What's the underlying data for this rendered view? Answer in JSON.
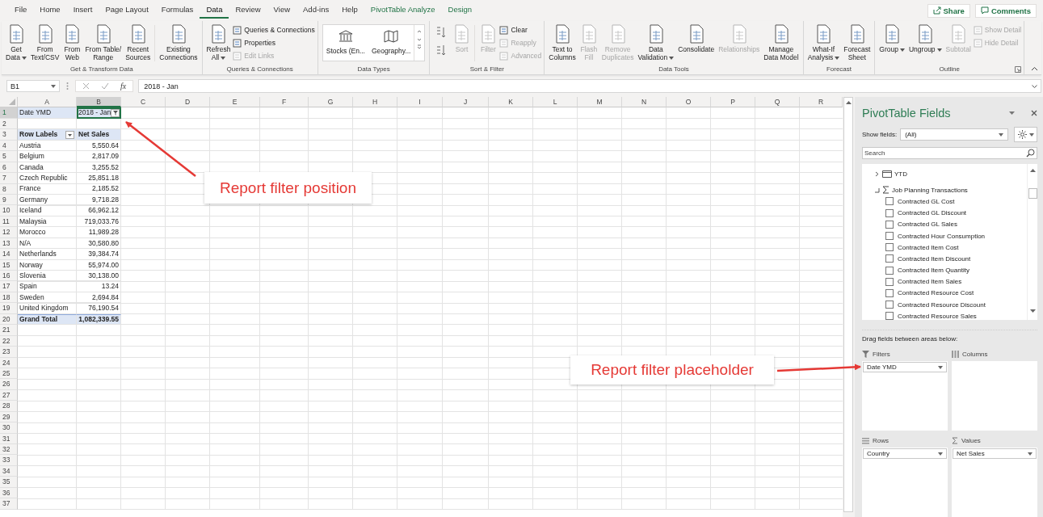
{
  "menu_tabs": [
    {
      "label": "File",
      "selected": false,
      "kind": "standard"
    },
    {
      "label": "Home",
      "selected": false,
      "kind": "standard"
    },
    {
      "label": "Insert",
      "selected": false,
      "kind": "standard"
    },
    {
      "label": "Page Layout",
      "selected": false,
      "kind": "standard"
    },
    {
      "label": "Formulas",
      "selected": false,
      "kind": "standard"
    },
    {
      "label": "Data",
      "selected": true,
      "kind": "standard"
    },
    {
      "label": "Review",
      "selected": false,
      "kind": "standard"
    },
    {
      "label": "View",
      "selected": false,
      "kind": "standard"
    },
    {
      "label": "Add-ins",
      "selected": false,
      "kind": "standard"
    },
    {
      "label": "Help",
      "selected": false,
      "kind": "standard"
    },
    {
      "label": "PivotTable Analyze",
      "selected": false,
      "kind": "contextual"
    },
    {
      "label": "Design",
      "selected": false,
      "kind": "contextual"
    }
  ],
  "top_buttons": [
    {
      "label": "Share",
      "kind": "share"
    },
    {
      "label": "Comments",
      "kind": "comments"
    }
  ],
  "ribbon": {
    "groups": [
      {
        "label": "Get & Transform Data",
        "items": [
          {
            "kind": "large",
            "lines": [
              "Get",
              "Data"
            ],
            "dropdown": true,
            "disabled": false
          },
          {
            "kind": "large",
            "lines": [
              "From",
              "Text/CSV"
            ],
            "disabled": false
          },
          {
            "kind": "large",
            "lines": [
              "From",
              "Web"
            ],
            "disabled": false
          },
          {
            "kind": "large",
            "lines": [
              "From Table/",
              "Range"
            ],
            "disabled": false
          },
          {
            "kind": "large",
            "lines": [
              "Recent",
              "Sources"
            ],
            "disabled": false
          },
          {
            "kind": "separator"
          },
          {
            "kind": "large",
            "lines": [
              "Existing",
              "Connections"
            ],
            "disabled": false
          }
        ]
      },
      {
        "label": "Queries & Connections",
        "items": [
          {
            "kind": "large",
            "lines": [
              "Refresh",
              "All"
            ],
            "dropdown": true,
            "disabled": false
          },
          {
            "kind": "small_stack",
            "items": [
              {
                "label": "Queries & Connections",
                "disabled": false
              },
              {
                "label": "Properties",
                "disabled": false
              },
              {
                "label": "Edit Links",
                "disabled": true
              }
            ]
          }
        ]
      },
      {
        "label": "Data Types",
        "items": [
          {
            "kind": "gallery",
            "options": [
              "Stocks (En...",
              "Geography..."
            ]
          }
        ]
      },
      {
        "label": "Sort & Filter",
        "items": [
          {
            "kind": "sort_pair",
            "disabled": false
          },
          {
            "kind": "large",
            "lines": [
              "Sort"
            ],
            "disabled": true
          },
          {
            "kind": "separator"
          },
          {
            "kind": "large",
            "lines": [
              "Filter"
            ],
            "disabled": true
          },
          {
            "kind": "small_stack",
            "items": [
              {
                "label": "Clear",
                "disabled": false
              },
              {
                "label": "Reapply",
                "disabled": true
              },
              {
                "label": "Advanced",
                "disabled": true
              }
            ]
          }
        ]
      },
      {
        "label": "Data Tools",
        "items": [
          {
            "kind": "large",
            "lines": [
              "Text to",
              "Columns"
            ],
            "disabled": false
          },
          {
            "kind": "large",
            "lines": [
              "Flash",
              "Fill"
            ],
            "disabled": true
          },
          {
            "kind": "large",
            "lines": [
              "Remove",
              "Duplicates"
            ],
            "disabled": true
          },
          {
            "kind": "large",
            "lines": [
              "Data",
              "Validation"
            ],
            "dropdown": true,
            "disabled": false
          },
          {
            "kind": "large",
            "lines": [
              "Consolidate"
            ],
            "disabled": false
          },
          {
            "kind": "large",
            "lines": [
              "Relationships"
            ],
            "disabled": true
          },
          {
            "kind": "large",
            "lines": [
              "Manage",
              "Data Model"
            ],
            "disabled": false
          }
        ]
      },
      {
        "label": "Forecast",
        "items": [
          {
            "kind": "large",
            "lines": [
              "What-If",
              "Analysis"
            ],
            "dropdown": true,
            "disabled": false
          },
          {
            "kind": "large",
            "lines": [
              "Forecast",
              "Sheet"
            ],
            "disabled": false
          }
        ]
      },
      {
        "label": "Outline",
        "launcher": true,
        "items": [
          {
            "kind": "large",
            "lines": [
              "Group"
            ],
            "dropdown": true,
            "disabled": false
          },
          {
            "kind": "large",
            "lines": [
              "Ungroup"
            ],
            "dropdown": true,
            "disabled": false
          },
          {
            "kind": "large",
            "lines": [
              "Subtotal"
            ],
            "disabled": true
          },
          {
            "kind": "small_stack",
            "items": [
              {
                "label": "Show Detail",
                "disabled": true
              },
              {
                "label": "Hide Detail",
                "disabled": true
              }
            ]
          }
        ]
      }
    ]
  },
  "formula_bar": {
    "name_box": "B1",
    "function_label": "fx",
    "formula": "2018 - Jan"
  },
  "sheet": {
    "columns": [
      "A",
      "B",
      "C",
      "D",
      "E",
      "F",
      "G",
      "H",
      "I",
      "J",
      "K",
      "L",
      "M",
      "N",
      "O",
      "P",
      "Q",
      "R"
    ],
    "row_numbers": [
      "1",
      "2",
      "3",
      "4",
      "5",
      "6",
      "7",
      "8",
      "9",
      "10",
      "11",
      "12",
      "13",
      "14",
      "15",
      "16",
      "17",
      "18",
      "19",
      "20",
      "21",
      "22",
      "23",
      "24",
      "25",
      "26",
      "27",
      "28",
      "29",
      "30",
      "31",
      "32",
      "33",
      "34",
      "35",
      "36",
      "37"
    ],
    "report_filter": {
      "label": "Date YMD",
      "value": "2018 - Jan",
      "selected": true
    },
    "pivot_header": {
      "row_labels": "Row Labels",
      "value_header": "Net Sales"
    },
    "pivot_rows": [
      {
        "label": "Austria",
        "value": "5,550.64"
      },
      {
        "label": "Belgium",
        "value": "2,817.09"
      },
      {
        "label": "Canada",
        "value": "3,255.52"
      },
      {
        "label": "Czech Republic",
        "value": "25,851.18"
      },
      {
        "label": "France",
        "value": "2,185.52"
      },
      {
        "label": "Germany",
        "value": "9,718.28"
      },
      {
        "label": "Iceland",
        "value": "66,962.12"
      },
      {
        "label": "Malaysia",
        "value": "719,033.76"
      },
      {
        "label": "Morocco",
        "value": "11,989.28"
      },
      {
        "label": "N/A",
        "value": "30,580.80"
      },
      {
        "label": "Netherlands",
        "value": "39,384.74"
      },
      {
        "label": "Norway",
        "value": "55,974.00"
      },
      {
        "label": "Slovenia",
        "value": "30,138.00"
      },
      {
        "label": "Spain",
        "value": "13.24"
      },
      {
        "label": "Sweden",
        "value": "2,694.84"
      },
      {
        "label": "United Kingdom",
        "value": "76,190.54"
      }
    ],
    "grand_total": {
      "label": "Grand Total",
      "value": "1,082,339.55"
    }
  },
  "annotations": [
    {
      "text": "Report filter position"
    },
    {
      "text": "Report filter placeholder"
    }
  ],
  "pivot_panel": {
    "title": "PivotTable Fields",
    "show_fields_label": "Show fields:",
    "show_fields_value": "(All)",
    "search_placeholder": "Search",
    "fields": [
      {
        "label": "YTD",
        "kind": "folder",
        "expanded": false
      },
      {
        "label": "Job Planning Transactions",
        "kind": "measure_group",
        "expanded": true,
        "children": [
          {
            "label": "Contracted GL Cost",
            "checked": false
          },
          {
            "label": "Contracted GL Discount",
            "checked": false
          },
          {
            "label": "Contracted GL Sales",
            "checked": false
          },
          {
            "label": "Contracted Hour Consumption",
            "checked": false
          },
          {
            "label": "Contracted Item Cost",
            "checked": false
          },
          {
            "label": "Contracted Item Discount",
            "checked": false
          },
          {
            "label": "Contracted Item Quantity",
            "checked": false
          },
          {
            "label": "Contracted Item Sales",
            "checked": false
          },
          {
            "label": "Contracted Resource Cost",
            "checked": false
          },
          {
            "label": "Contracted Resource Discount",
            "checked": false
          },
          {
            "label": "Contracted Resource Sales",
            "checked": false
          }
        ]
      }
    ],
    "areas_hint": "Drag fields between areas below:",
    "areas": [
      {
        "name": "Filters",
        "kind": "filters",
        "fields": [
          "Date YMD"
        ]
      },
      {
        "name": "Columns",
        "kind": "columns"
      },
      {
        "name": "Rows",
        "kind": "rows",
        "fields": [
          "Country"
        ]
      },
      {
        "name": "Values",
        "kind": "values",
        "fields": [
          "Net Sales"
        ]
      }
    ]
  }
}
